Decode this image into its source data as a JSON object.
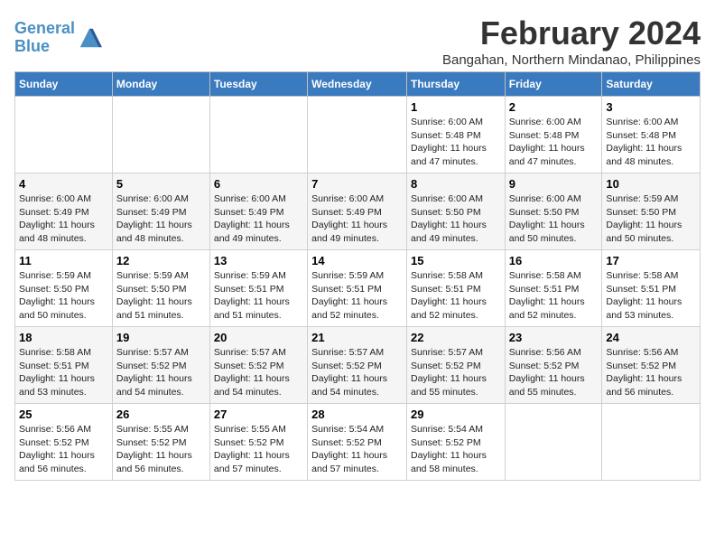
{
  "logo": {
    "line1": "General",
    "line2": "Blue"
  },
  "title": {
    "month_year": "February 2024",
    "location": "Bangahan, Northern Mindanao, Philippines"
  },
  "days_of_week": [
    "Sunday",
    "Monday",
    "Tuesday",
    "Wednesday",
    "Thursday",
    "Friday",
    "Saturday"
  ],
  "weeks": [
    [
      {
        "day": "",
        "info": ""
      },
      {
        "day": "",
        "info": ""
      },
      {
        "day": "",
        "info": ""
      },
      {
        "day": "",
        "info": ""
      },
      {
        "day": "1",
        "info": "Sunrise: 6:00 AM\nSunset: 5:48 PM\nDaylight: 11 hours and 47 minutes."
      },
      {
        "day": "2",
        "info": "Sunrise: 6:00 AM\nSunset: 5:48 PM\nDaylight: 11 hours and 47 minutes."
      },
      {
        "day": "3",
        "info": "Sunrise: 6:00 AM\nSunset: 5:48 PM\nDaylight: 11 hours and 48 minutes."
      }
    ],
    [
      {
        "day": "4",
        "info": "Sunrise: 6:00 AM\nSunset: 5:49 PM\nDaylight: 11 hours and 48 minutes."
      },
      {
        "day": "5",
        "info": "Sunrise: 6:00 AM\nSunset: 5:49 PM\nDaylight: 11 hours and 48 minutes."
      },
      {
        "day": "6",
        "info": "Sunrise: 6:00 AM\nSunset: 5:49 PM\nDaylight: 11 hours and 49 minutes."
      },
      {
        "day": "7",
        "info": "Sunrise: 6:00 AM\nSunset: 5:49 PM\nDaylight: 11 hours and 49 minutes."
      },
      {
        "day": "8",
        "info": "Sunrise: 6:00 AM\nSunset: 5:50 PM\nDaylight: 11 hours and 49 minutes."
      },
      {
        "day": "9",
        "info": "Sunrise: 6:00 AM\nSunset: 5:50 PM\nDaylight: 11 hours and 50 minutes."
      },
      {
        "day": "10",
        "info": "Sunrise: 5:59 AM\nSunset: 5:50 PM\nDaylight: 11 hours and 50 minutes."
      }
    ],
    [
      {
        "day": "11",
        "info": "Sunrise: 5:59 AM\nSunset: 5:50 PM\nDaylight: 11 hours and 50 minutes."
      },
      {
        "day": "12",
        "info": "Sunrise: 5:59 AM\nSunset: 5:50 PM\nDaylight: 11 hours and 51 minutes."
      },
      {
        "day": "13",
        "info": "Sunrise: 5:59 AM\nSunset: 5:51 PM\nDaylight: 11 hours and 51 minutes."
      },
      {
        "day": "14",
        "info": "Sunrise: 5:59 AM\nSunset: 5:51 PM\nDaylight: 11 hours and 52 minutes."
      },
      {
        "day": "15",
        "info": "Sunrise: 5:58 AM\nSunset: 5:51 PM\nDaylight: 11 hours and 52 minutes."
      },
      {
        "day": "16",
        "info": "Sunrise: 5:58 AM\nSunset: 5:51 PM\nDaylight: 11 hours and 52 minutes."
      },
      {
        "day": "17",
        "info": "Sunrise: 5:58 AM\nSunset: 5:51 PM\nDaylight: 11 hours and 53 minutes."
      }
    ],
    [
      {
        "day": "18",
        "info": "Sunrise: 5:58 AM\nSunset: 5:51 PM\nDaylight: 11 hours and 53 minutes."
      },
      {
        "day": "19",
        "info": "Sunrise: 5:57 AM\nSunset: 5:52 PM\nDaylight: 11 hours and 54 minutes."
      },
      {
        "day": "20",
        "info": "Sunrise: 5:57 AM\nSunset: 5:52 PM\nDaylight: 11 hours and 54 minutes."
      },
      {
        "day": "21",
        "info": "Sunrise: 5:57 AM\nSunset: 5:52 PM\nDaylight: 11 hours and 54 minutes."
      },
      {
        "day": "22",
        "info": "Sunrise: 5:57 AM\nSunset: 5:52 PM\nDaylight: 11 hours and 55 minutes."
      },
      {
        "day": "23",
        "info": "Sunrise: 5:56 AM\nSunset: 5:52 PM\nDaylight: 11 hours and 55 minutes."
      },
      {
        "day": "24",
        "info": "Sunrise: 5:56 AM\nSunset: 5:52 PM\nDaylight: 11 hours and 56 minutes."
      }
    ],
    [
      {
        "day": "25",
        "info": "Sunrise: 5:56 AM\nSunset: 5:52 PM\nDaylight: 11 hours and 56 minutes."
      },
      {
        "day": "26",
        "info": "Sunrise: 5:55 AM\nSunset: 5:52 PM\nDaylight: 11 hours and 56 minutes."
      },
      {
        "day": "27",
        "info": "Sunrise: 5:55 AM\nSunset: 5:52 PM\nDaylight: 11 hours and 57 minutes."
      },
      {
        "day": "28",
        "info": "Sunrise: 5:54 AM\nSunset: 5:52 PM\nDaylight: 11 hours and 57 minutes."
      },
      {
        "day": "29",
        "info": "Sunrise: 5:54 AM\nSunset: 5:52 PM\nDaylight: 11 hours and 58 minutes."
      },
      {
        "day": "",
        "info": ""
      },
      {
        "day": "",
        "info": ""
      }
    ]
  ]
}
